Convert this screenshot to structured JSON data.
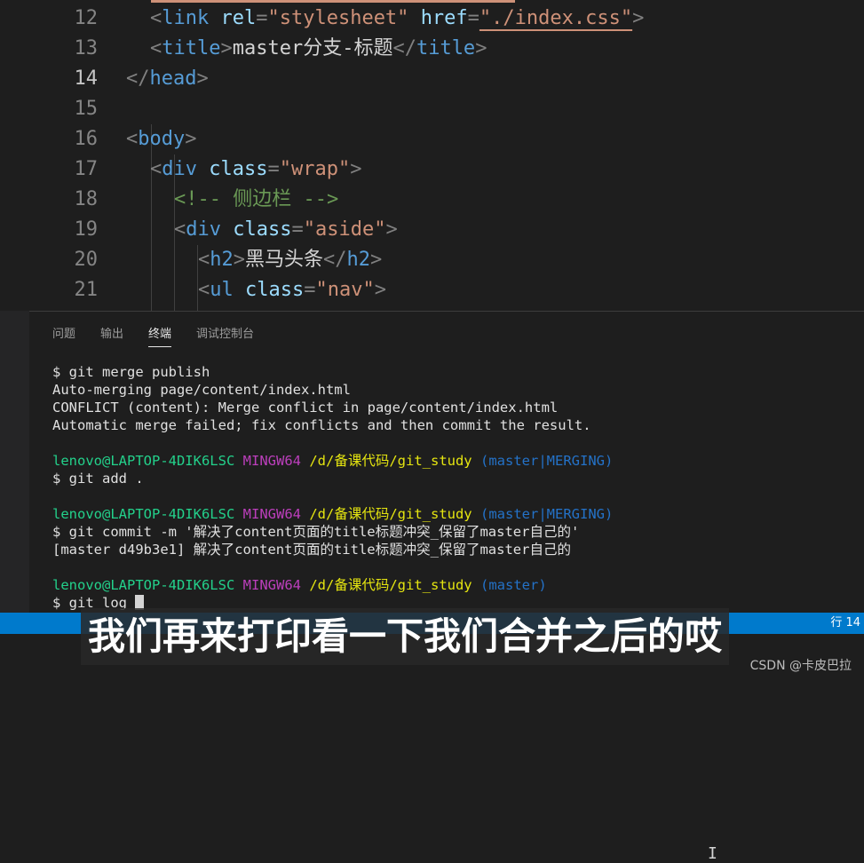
{
  "editor": {
    "lines": [
      {
        "num": "12",
        "tokens": [
          [
            "pun",
            "<"
          ],
          [
            "tag",
            "link"
          ],
          [
            "txt",
            " "
          ],
          [
            "attr",
            "rel"
          ],
          [
            "pun",
            "="
          ],
          [
            "str",
            "\"stylesheet\""
          ],
          [
            "txt",
            " "
          ],
          [
            "attr",
            "href"
          ],
          [
            "pun",
            "="
          ],
          [
            "str",
            "\"./index.css\""
          ],
          [
            "pun",
            ">"
          ]
        ]
      },
      {
        "num": "13",
        "tokens": [
          [
            "pun",
            "<"
          ],
          [
            "tag",
            "title"
          ],
          [
            "pun",
            ">"
          ],
          [
            "txt",
            "master分支-标题"
          ],
          [
            "pun",
            "</"
          ],
          [
            "tag",
            "title"
          ],
          [
            "pun",
            ">"
          ]
        ]
      },
      {
        "num": "14",
        "tokens": [
          [
            "pun",
            "</"
          ],
          [
            "tag",
            "head"
          ],
          [
            "pun",
            ">"
          ]
        ]
      },
      {
        "num": "15",
        "tokens": []
      },
      {
        "num": "16",
        "tokens": [
          [
            "pun",
            "<"
          ],
          [
            "tag",
            "body"
          ],
          [
            "pun",
            ">"
          ]
        ]
      },
      {
        "num": "17",
        "tokens": [
          [
            "pun",
            "<"
          ],
          [
            "tag",
            "div"
          ],
          [
            "txt",
            " "
          ],
          [
            "attr",
            "class"
          ],
          [
            "pun",
            "="
          ],
          [
            "str",
            "\"wrap\""
          ],
          [
            "pun",
            ">"
          ]
        ]
      },
      {
        "num": "18",
        "tokens": [
          [
            "cmt",
            "<!-- 侧边栏 -->"
          ]
        ]
      },
      {
        "num": "19",
        "tokens": [
          [
            "pun",
            "<"
          ],
          [
            "tag",
            "div"
          ],
          [
            "txt",
            " "
          ],
          [
            "attr",
            "class"
          ],
          [
            "pun",
            "="
          ],
          [
            "str",
            "\"aside\""
          ],
          [
            "pun",
            ">"
          ]
        ]
      },
      {
        "num": "20",
        "tokens": [
          [
            "pun",
            "<"
          ],
          [
            "tag",
            "h2"
          ],
          [
            "pun",
            ">"
          ],
          [
            "txt",
            "黑马头条"
          ],
          [
            "pun",
            "</"
          ],
          [
            "tag",
            "h2"
          ],
          [
            "pun",
            ">"
          ]
        ]
      },
      {
        "num": "21",
        "tokens": [
          [
            "pun",
            "<"
          ],
          [
            "tag",
            "ul"
          ],
          [
            "txt",
            " "
          ],
          [
            "attr",
            "class"
          ],
          [
            "pun",
            "="
          ],
          [
            "str",
            "\"nav\""
          ],
          [
            "pun",
            ">"
          ]
        ]
      }
    ]
  },
  "panel": {
    "tabs": [
      "问题",
      "输出",
      "终端",
      "调试控制台"
    ],
    "active_tab": "终端"
  },
  "terminal": {
    "lines": [
      [
        [
          "w",
          "$ git merge publish"
        ]
      ],
      [
        [
          "w",
          "Auto-merging page/content/index.html"
        ]
      ],
      [
        [
          "w",
          "CONFLICT (content): Merge conflict in page/content/index.html"
        ]
      ],
      [
        [
          "w",
          "Automatic merge failed; fix conflicts and then commit the result."
        ]
      ],
      [],
      [
        [
          "u",
          "lenovo@LAPTOP-4DIK6LSC"
        ],
        [
          "w",
          " "
        ],
        [
          "m",
          "MINGW64"
        ],
        [
          "w",
          " "
        ],
        [
          "p",
          "/d/备课代码/git_study"
        ],
        [
          "w",
          " "
        ],
        [
          "b",
          "(master|MERGING)"
        ]
      ],
      [
        [
          "w",
          "$ git add ."
        ]
      ],
      [],
      [
        [
          "u",
          "lenovo@LAPTOP-4DIK6LSC"
        ],
        [
          "w",
          " "
        ],
        [
          "m",
          "MINGW64"
        ],
        [
          "w",
          " "
        ],
        [
          "p",
          "/d/备课代码/git_study"
        ],
        [
          "w",
          " "
        ],
        [
          "b",
          "(master|MERGING)"
        ]
      ],
      [
        [
          "w",
          "$ git commit -m '解决了content页面的title标题冲突_保留了master自己的'"
        ]
      ],
      [
        [
          "w",
          "[master d49b3e1] 解决了content页面的title标题冲突_保留了master自己的"
        ]
      ],
      [],
      [
        [
          "u",
          "lenovo@LAPTOP-4DIK6LSC"
        ],
        [
          "w",
          " "
        ],
        [
          "m",
          "MINGW64"
        ],
        [
          "w",
          " "
        ],
        [
          "p",
          "/d/备课代码/git_study"
        ],
        [
          "w",
          " "
        ],
        [
          "b",
          "(master)"
        ]
      ],
      [
        [
          "w",
          "$ git log "
        ]
      ]
    ]
  },
  "status": {
    "right_text": "行 14"
  },
  "subtitle": "我们再来打印看一下我们合并之后的哎",
  "watermark": "CSDN @卡皮巴拉",
  "cursor_glyph": "I"
}
